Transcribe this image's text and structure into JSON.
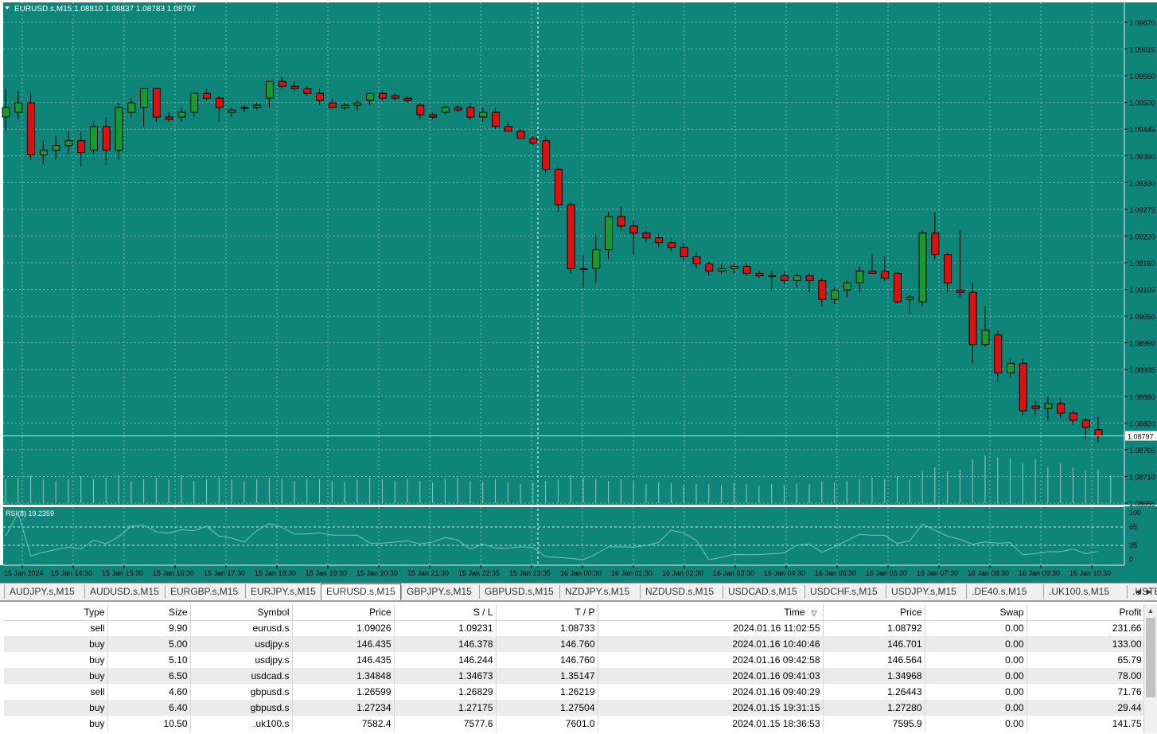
{
  "chart": {
    "header_text": "EURUSD.s,M15  1.08810 1.08837 1.08783 1.08797",
    "current_price_label": "1.08797",
    "colors": {
      "background": "#0f857a",
      "grid": "#74b8b0",
      "bull_body": "#1a9a2e",
      "bear_body": "#e01010",
      "wick": "#000000",
      "volume": "#8cc8c0",
      "axis_text": "#000000",
      "rsi_line": "#6ac4bc"
    },
    "price_labels": [
      "1.09670",
      "1.09615",
      "1.09560",
      "1.09500",
      "1.09445",
      "1.09390",
      "1.09330",
      "1.09275",
      "1.09220",
      "1.09160",
      "1.09105",
      "1.09050",
      "1.08990",
      "1.08935",
      "1.08880",
      "1.08820",
      "1.08765",
      "1.08710",
      "1.08655"
    ],
    "rsi_panel": {
      "label": "RSI(8) 19.2359",
      "levels": [
        "100",
        "65",
        "35",
        "0"
      ]
    },
    "time_labels": [
      "15 Jan 2024",
      "15 Jan 14:30",
      "15 Jan 15:30",
      "15 Jan 16:30",
      "15 Jan 17:30",
      "15 Jan 18:30",
      "15 Jan 19:30",
      "15 Jan 20:30",
      "15 Jan 21:30",
      "15 Jan 22:35",
      "15 Jan 23:35",
      "16 Jan 00:30",
      "16 Jan 01:30",
      "16 Jan 02:30",
      "16 Jan 03:30",
      "16 Jan 04:30",
      "16 Jan 05:30",
      "16 Jan 06:30",
      "16 Jan 07:30",
      "16 Jan 08:30",
      "16 Jan 09:30",
      "16 Jan 10:30"
    ],
    "candles": [
      {
        "o": 1.0947,
        "h": 1.0953,
        "l": 1.0944,
        "c": 1.0949
      },
      {
        "o": 1.0948,
        "h": 1.09525,
        "l": 1.09465,
        "c": 1.095
      },
      {
        "o": 1.095,
        "h": 1.0952,
        "l": 1.0938,
        "c": 1.0939
      },
      {
        "o": 1.0939,
        "h": 1.0942,
        "l": 1.0937,
        "c": 1.094
      },
      {
        "o": 1.094,
        "h": 1.0943,
        "l": 1.0938,
        "c": 1.0941
      },
      {
        "o": 1.0941,
        "h": 1.0944,
        "l": 1.0939,
        "c": 1.0942
      },
      {
        "o": 1.0942,
        "h": 1.0944,
        "l": 1.09365,
        "c": 1.09395
      },
      {
        "o": 1.094,
        "h": 1.0946,
        "l": 1.0939,
        "c": 1.0945
      },
      {
        "o": 1.0945,
        "h": 1.0947,
        "l": 1.0937,
        "c": 1.094
      },
      {
        "o": 1.094,
        "h": 1.095,
        "l": 1.0938,
        "c": 1.0949
      },
      {
        "o": 1.0948,
        "h": 1.0951,
        "l": 1.0947,
        "c": 1.095
      },
      {
        "o": 1.0949,
        "h": 1.0953,
        "l": 1.0945,
        "c": 1.0953
      },
      {
        "o": 1.0953,
        "h": 1.0953,
        "l": 1.0946,
        "c": 1.0947
      },
      {
        "o": 1.0947,
        "h": 1.0948,
        "l": 1.0946,
        "c": 1.09465
      },
      {
        "o": 1.0947,
        "h": 1.0949,
        "l": 1.0946,
        "c": 1.0948
      },
      {
        "o": 1.0948,
        "h": 1.0952,
        "l": 1.0947,
        "c": 1.0952
      },
      {
        "o": 1.0952,
        "h": 1.0953,
        "l": 1.09505,
        "c": 1.0951
      },
      {
        "o": 1.0951,
        "h": 1.09515,
        "l": 1.0946,
        "c": 1.0949
      },
      {
        "o": 1.0948,
        "h": 1.0949,
        "l": 1.0947,
        "c": 1.09485
      },
      {
        "o": 1.0949,
        "h": 1.09495,
        "l": 1.0948,
        "c": 1.0949
      },
      {
        "o": 1.0949,
        "h": 1.095,
        "l": 1.09485,
        "c": 1.09495
      },
      {
        "o": 1.0951,
        "h": 1.09545,
        "l": 1.0949,
        "c": 1.09545
      },
      {
        "o": 1.09545,
        "h": 1.09555,
        "l": 1.0953,
        "c": 1.09535
      },
      {
        "o": 1.09535,
        "h": 1.09545,
        "l": 1.09525,
        "c": 1.0953
      },
      {
        "o": 1.0953,
        "h": 1.09535,
        "l": 1.09515,
        "c": 1.0952
      },
      {
        "o": 1.0952,
        "h": 1.0953,
        "l": 1.09495,
        "c": 1.09505
      },
      {
        "o": 1.095,
        "h": 1.0951,
        "l": 1.0949,
        "c": 1.0949
      },
      {
        "o": 1.0949,
        "h": 1.095,
        "l": 1.09485,
        "c": 1.09495
      },
      {
        "o": 1.09495,
        "h": 1.09505,
        "l": 1.09485,
        "c": 1.095
      },
      {
        "o": 1.09505,
        "h": 1.0952,
        "l": 1.09495,
        "c": 1.0952
      },
      {
        "o": 1.0952,
        "h": 1.09525,
        "l": 1.09505,
        "c": 1.0951
      },
      {
        "o": 1.09515,
        "h": 1.0952,
        "l": 1.09505,
        "c": 1.0951
      },
      {
        "o": 1.0951,
        "h": 1.09515,
        "l": 1.095,
        "c": 1.09505
      },
      {
        "o": 1.09495,
        "h": 1.095,
        "l": 1.09465,
        "c": 1.09475
      },
      {
        "o": 1.09475,
        "h": 1.0948,
        "l": 1.09465,
        "c": 1.0947
      },
      {
        "o": 1.0948,
        "h": 1.09495,
        "l": 1.09475,
        "c": 1.0949
      },
      {
        "o": 1.0949,
        "h": 1.09495,
        "l": 1.0948,
        "c": 1.09485
      },
      {
        "o": 1.0949,
        "h": 1.095,
        "l": 1.09465,
        "c": 1.0947
      },
      {
        "o": 1.0947,
        "h": 1.0949,
        "l": 1.0946,
        "c": 1.0948
      },
      {
        "o": 1.0948,
        "h": 1.0949,
        "l": 1.09445,
        "c": 1.0945
      },
      {
        "o": 1.0945,
        "h": 1.0946,
        "l": 1.0944,
        "c": 1.0944
      },
      {
        "o": 1.0944,
        "h": 1.09445,
        "l": 1.09425,
        "c": 1.09425
      },
      {
        "o": 1.09425,
        "h": 1.0943,
        "l": 1.0941,
        "c": 1.09415
      },
      {
        "o": 1.0942,
        "h": 1.0943,
        "l": 1.0935,
        "c": 1.0936
      },
      {
        "o": 1.0936,
        "h": 1.09365,
        "l": 1.0927,
        "c": 1.09285
      },
      {
        "o": 1.09285,
        "h": 1.0929,
        "l": 1.0914,
        "c": 1.0915
      },
      {
        "o": 1.0915,
        "h": 1.0918,
        "l": 1.0911,
        "c": 1.0915
      },
      {
        "o": 1.0915,
        "h": 1.0922,
        "l": 1.0912,
        "c": 1.0919
      },
      {
        "o": 1.0919,
        "h": 1.0927,
        "l": 1.0917,
        "c": 1.0926
      },
      {
        "o": 1.0926,
        "h": 1.0928,
        "l": 1.0923,
        "c": 1.0924
      },
      {
        "o": 1.0924,
        "h": 1.0925,
        "l": 1.0918,
        "c": 1.09225
      },
      {
        "o": 1.09225,
        "h": 1.0923,
        "l": 1.09205,
        "c": 1.09215
      },
      {
        "o": 1.09215,
        "h": 1.09225,
        "l": 1.09195,
        "c": 1.09205
      },
      {
        "o": 1.09205,
        "h": 1.09215,
        "l": 1.09185,
        "c": 1.09195
      },
      {
        "o": 1.09195,
        "h": 1.09205,
        "l": 1.09165,
        "c": 1.09175
      },
      {
        "o": 1.09175,
        "h": 1.09185,
        "l": 1.0915,
        "c": 1.0916
      },
      {
        "o": 1.0916,
        "h": 1.09165,
        "l": 1.09135,
        "c": 1.09145
      },
      {
        "o": 1.09145,
        "h": 1.0916,
        "l": 1.0914,
        "c": 1.0915
      },
      {
        "o": 1.0915,
        "h": 1.0916,
        "l": 1.0914,
        "c": 1.09155
      },
      {
        "o": 1.09155,
        "h": 1.0916,
        "l": 1.09135,
        "c": 1.0914
      },
      {
        "o": 1.0914,
        "h": 1.09145,
        "l": 1.0913,
        "c": 1.09135
      },
      {
        "o": 1.09135,
        "h": 1.09145,
        "l": 1.09105,
        "c": 1.09135
      },
      {
        "o": 1.09135,
        "h": 1.09145,
        "l": 1.09115,
        "c": 1.09125
      },
      {
        "o": 1.09125,
        "h": 1.0914,
        "l": 1.0911,
        "c": 1.09135
      },
      {
        "o": 1.09135,
        "h": 1.0914,
        "l": 1.091,
        "c": 1.09125
      },
      {
        "o": 1.09125,
        "h": 1.0913,
        "l": 1.0907,
        "c": 1.09085
      },
      {
        "o": 1.09085,
        "h": 1.0911,
        "l": 1.09075,
        "c": 1.09105
      },
      {
        "o": 1.09105,
        "h": 1.09125,
        "l": 1.0909,
        "c": 1.0912
      },
      {
        "o": 1.0912,
        "h": 1.09155,
        "l": 1.091,
        "c": 1.09145
      },
      {
        "o": 1.09145,
        "h": 1.0918,
        "l": 1.0914,
        "c": 1.0914
      },
      {
        "o": 1.09145,
        "h": 1.09175,
        "l": 1.09125,
        "c": 1.0913
      },
      {
        "o": 1.0914,
        "h": 1.09145,
        "l": 1.09075,
        "c": 1.0908
      },
      {
        "o": 1.09085,
        "h": 1.09095,
        "l": 1.09055,
        "c": 1.0909
      },
      {
        "o": 1.0908,
        "h": 1.0923,
        "l": 1.0907,
        "c": 1.09225
      },
      {
        "o": 1.09225,
        "h": 1.0927,
        "l": 1.0917,
        "c": 1.0918
      },
      {
        "o": 1.0918,
        "h": 1.09185,
        "l": 1.091,
        "c": 1.0912
      },
      {
        "o": 1.09105,
        "h": 1.0923,
        "l": 1.0909,
        "c": 1.091
      },
      {
        "o": 1.091,
        "h": 1.0912,
        "l": 1.0895,
        "c": 1.0899
      },
      {
        "o": 1.0899,
        "h": 1.0907,
        "l": 1.08985,
        "c": 1.0902
      },
      {
        "o": 1.0901,
        "h": 1.0902,
        "l": 1.0891,
        "c": 1.0893
      },
      {
        "o": 1.0893,
        "h": 1.0896,
        "l": 1.0892,
        "c": 1.0895
      },
      {
        "o": 1.0895,
        "h": 1.0896,
        "l": 1.0884,
        "c": 1.0885
      },
      {
        "o": 1.0886,
        "h": 1.0887,
        "l": 1.0884,
        "c": 1.08855
      },
      {
        "o": 1.08855,
        "h": 1.0888,
        "l": 1.0883,
        "c": 1.08865
      },
      {
        "o": 1.08865,
        "h": 1.08875,
        "l": 1.08835,
        "c": 1.08845
      },
      {
        "o": 1.08845,
        "h": 1.0885,
        "l": 1.0882,
        "c": 1.0883
      },
      {
        "o": 1.0883,
        "h": 1.08835,
        "l": 1.0879,
        "c": 1.08815
      },
      {
        "o": 1.0881,
        "h": 1.08837,
        "l": 1.08783,
        "c": 1.08797
      }
    ],
    "volumes": [
      30,
      32,
      35,
      30,
      28,
      30,
      34,
      30,
      32,
      35,
      28,
      30,
      32,
      30,
      35,
      28,
      30,
      32,
      30,
      28,
      30,
      32,
      30,
      28,
      30,
      30,
      28,
      26,
      30,
      32,
      30,
      28,
      30,
      28,
      26,
      30,
      32,
      28,
      26,
      30,
      26,
      24,
      26,
      28,
      30,
      35,
      32,
      30,
      28,
      30,
      26,
      24,
      26,
      25,
      22,
      24,
      24,
      22,
      25,
      24,
      22,
      24,
      23,
      25,
      24,
      28,
      26,
      28,
      30,
      32,
      30,
      34,
      30,
      40,
      45,
      40,
      42,
      55,
      60,
      58,
      56,
      50,
      55,
      45,
      50,
      45,
      40,
      42,
      35
    ]
  },
  "tabs": {
    "items": [
      "AUDJPY.s,M15",
      "AUDUSD.s,M15",
      "EURGBP.s,M15",
      "EURJPY.s,M15",
      "EURUSD.s,M15",
      "GBPJPY.s,M15",
      "GBPUSD.s,M15",
      "NZDJPY.s,M15",
      "NZDUSD.s,M15",
      "USDCAD.s,M15",
      "USDCHF.s,M15",
      "USDJPY.s,M15",
      ".DE40.s,M15",
      ".UK100.s,M15",
      ".USTEC"
    ],
    "active": "EURUSD.s,M15"
  },
  "trade_table": {
    "headers": [
      "Type",
      "Size",
      "Symbol",
      "Price",
      "S / L",
      "T / P",
      "Time",
      "Price",
      "Swap",
      "Profit"
    ],
    "sort_indicator": "▽",
    "rows": [
      [
        "sell",
        "9.90",
        "eurusd.s",
        "1.09026",
        "1.09231",
        "1.08733",
        "2024.01.16 11:02:55",
        "1.08792",
        "0.00",
        "231.66"
      ],
      [
        "buy",
        "5.00",
        "usdjpy.s",
        "146.435",
        "146.378",
        "146.760",
        "2024.01.16 10:40:46",
        "146.701",
        "0.00",
        "133.00"
      ],
      [
        "buy",
        "5.10",
        "usdjpy.s",
        "146.435",
        "146.244",
        "146.760",
        "2024.01.16 09:42:58",
        "146.564",
        "0.00",
        "65.79"
      ],
      [
        "buy",
        "6.50",
        "usdcad.s",
        "1.34848",
        "1.34673",
        "1.35147",
        "2024.01.16 09:41:03",
        "1.34968",
        "0.00",
        "78.00"
      ],
      [
        "sell",
        "4.60",
        "gbpusd.s",
        "1.26599",
        "1.26829",
        "1.26219",
        "2024.01.16 09:40:29",
        "1.26443",
        "0.00",
        "71.76"
      ],
      [
        "buy",
        "6.40",
        "gbpusd.s",
        "1.27234",
        "1.27175",
        "1.27504",
        "2024.01.15 19:31:15",
        "1.27280",
        "0.00",
        "29.44"
      ],
      [
        "buy",
        "10.50",
        ".uk100.s",
        "7582.4",
        "7577.6",
        "7601.0",
        "2024.01.15 18:36:53",
        "7595.9",
        "0.00",
        "141.75"
      ]
    ]
  }
}
